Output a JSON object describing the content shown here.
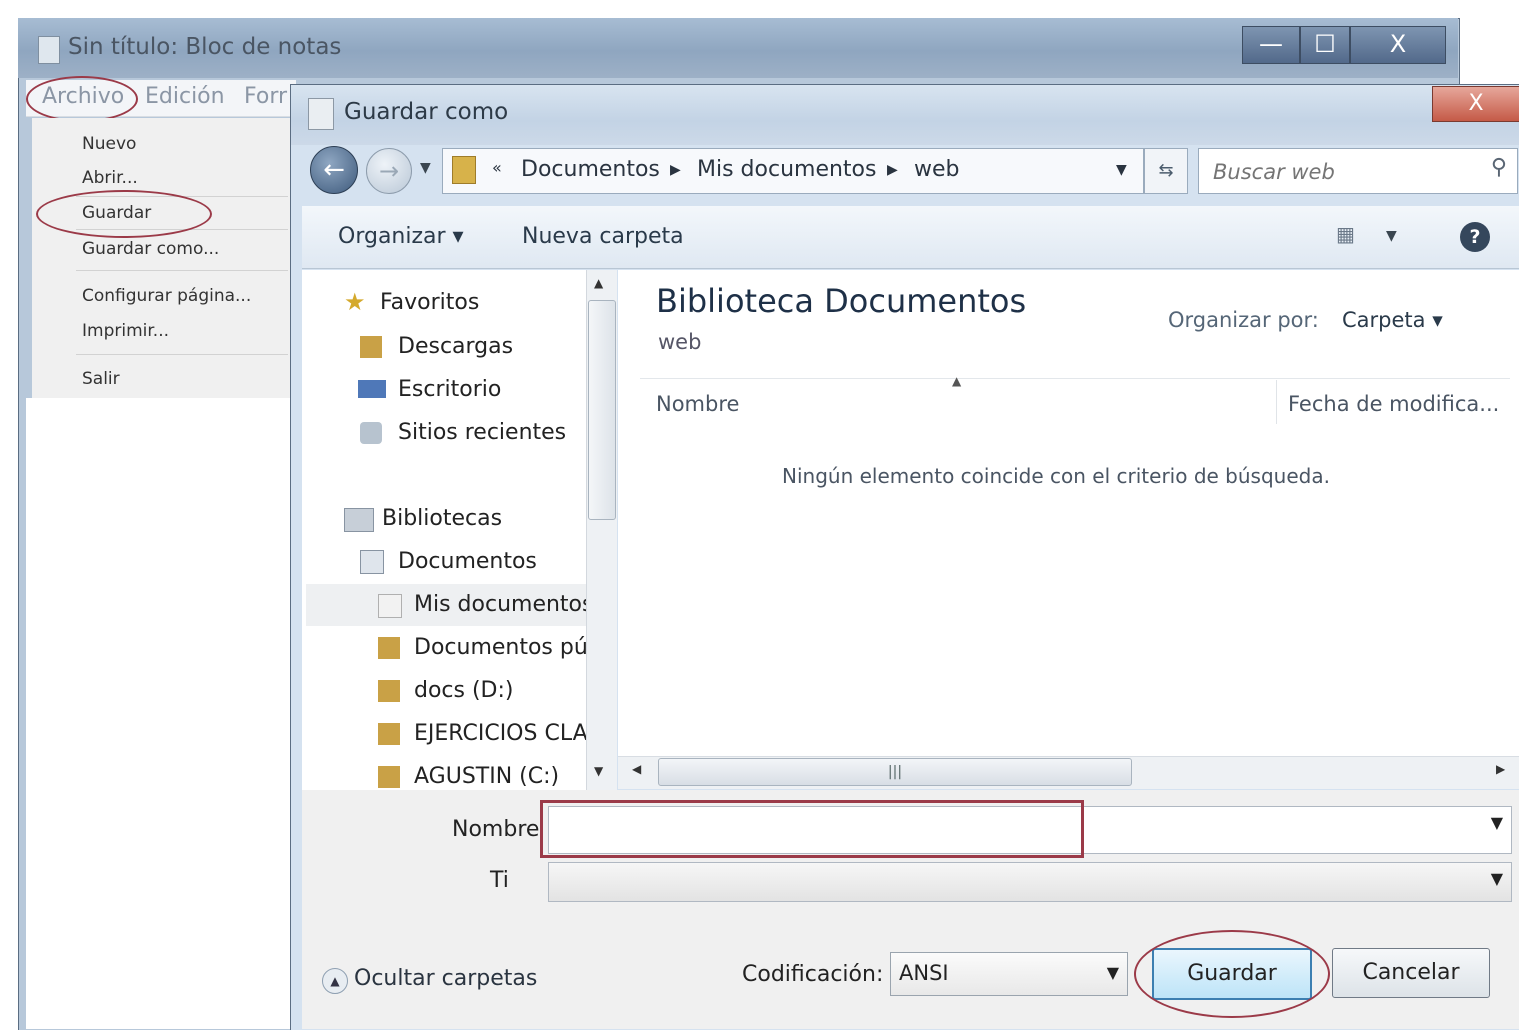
{
  "notepad": {
    "title": "Sin título: Bloc de notas",
    "menu": [
      "Archivo",
      "Edición",
      "Forr"
    ],
    "file_menu": {
      "items": [
        "Nuevo",
        "Abrir...",
        "Guardar",
        "Guardar como...",
        "Configurar página...",
        "Imprimir...",
        "Salir"
      ]
    },
    "window_buttons": {
      "minimize": "—",
      "maximize": "☐",
      "close": "X"
    }
  },
  "dialog": {
    "title": "Guardar como",
    "close": "X",
    "breadcrumb": [
      "«",
      "Documentos",
      "Mis documentos",
      "web"
    ],
    "search_placeholder": "Buscar web",
    "toolbar": {
      "organize": "Organizar ▾",
      "new_folder": "Nueva carpeta"
    },
    "nav": {
      "favorites": [
        "Favoritos",
        "Descargas",
        "Escritorio",
        "Sitios recientes"
      ],
      "libraries": [
        "Bibliotecas",
        "Documentos",
        "Mis documentos",
        "Documentos pú",
        "docs (D:)",
        "EJERCICIOS CLA",
        "AGUSTIN (C:)"
      ]
    },
    "content": {
      "library_title": "Biblioteca Documentos",
      "library_sub": "web",
      "arrange_label": "Organizar por:",
      "arrange_value": "Carpeta ▾",
      "col_name": "Nombre",
      "col_date": "Fecha de modifica...",
      "empty_message": "Ningún elemento coincide con el criterio de búsqueda."
    },
    "form": {
      "name_label": "Nombre",
      "name_value": "",
      "type_label": "Ti",
      "type_value": "",
      "hide_folders": "Ocultar carpetas",
      "encoding_label": "Codificación:",
      "encoding_value": "ANSI",
      "save_button": "Guardar",
      "cancel_button": "Cancelar"
    }
  },
  "colors": {
    "annotation": "#9b3a48",
    "title_accent": "#1e3047"
  }
}
